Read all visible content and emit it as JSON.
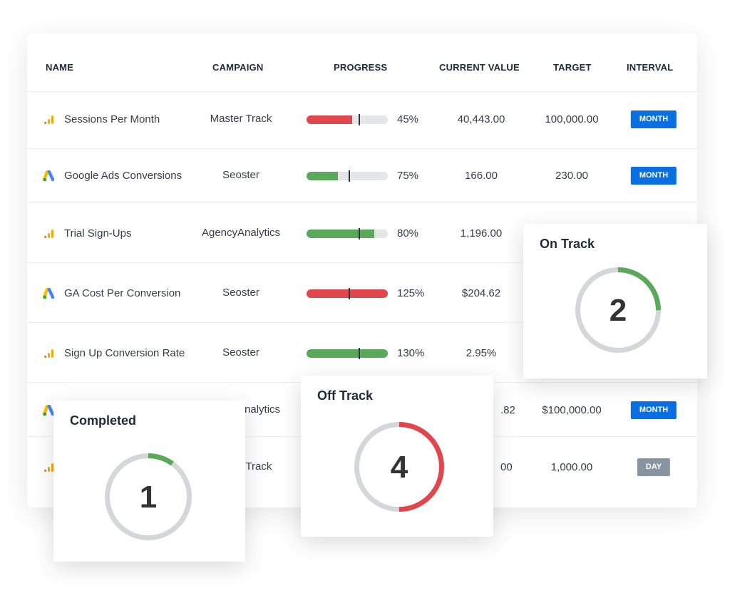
{
  "colors": {
    "red": "#e0474c",
    "green": "#5aa95a",
    "blue": "#0a6fe0",
    "gray": "#8795a1",
    "track": "#d3d7d9"
  },
  "headers": {
    "name": "NAME",
    "campaign": "CAMPAIGN",
    "progress": "PROGRESS",
    "current": "CURRENT VALUE",
    "target": "TARGET",
    "interval": "INTERVAL"
  },
  "rows": [
    {
      "icon": "google-analytics-icon",
      "name": "Sessions Per Month",
      "campaign": "Master Track",
      "pct": "45%",
      "status": "red",
      "fill": 0.56,
      "marker": 0.65,
      "current": "40,443.00",
      "target": "100,000.00",
      "interval": "MONTH"
    },
    {
      "icon": "google-ads-icon",
      "name": "Google Ads Conversions",
      "campaign": "Seoster",
      "pct": "75%",
      "status": "green",
      "fill": 0.39,
      "marker": 0.53,
      "current": "166.00",
      "target": "230.00",
      "interval": "MONTH"
    },
    {
      "icon": "google-analytics-icon",
      "name": "Trial Sign-Ups",
      "campaign": "AgencyAnalytics",
      "pct": "80%",
      "status": "green",
      "fill": 0.83,
      "marker": 0.65,
      "current": "1,196.00"
    },
    {
      "icon": "google-ads-icon",
      "name": "GA Cost Per Conversion",
      "campaign": "Seoster",
      "pct": "125%",
      "status": "red",
      "fill": 1,
      "marker": 0.53,
      "current": "$204.62"
    },
    {
      "icon": "google-analytics-icon",
      "name": "Sign Up Conversion Rate",
      "campaign": "Seoster",
      "pct": "130%",
      "status": "green",
      "fill": 1,
      "marker": 0.65,
      "current": "2.95%"
    },
    {
      "icon": "google-ads-icon",
      "campaign": "AgencyAnalytics",
      "current": ".82",
      "target": "$100,000.00",
      "interval": "MONTH"
    },
    {
      "icon": "google-analytics-icon",
      "campaign": "Master Track",
      "current": "00",
      "target": "1,000.00",
      "interval": "DAY",
      "interval_color": "gray"
    }
  ],
  "cards": {
    "on_track": {
      "title": "On Track",
      "count": "2",
      "fraction": 0.25,
      "color": "green"
    },
    "off_track": {
      "title": "Off Track",
      "count": "4",
      "fraction": 0.5,
      "color": "red"
    },
    "completed": {
      "title": "Completed",
      "count": "1",
      "fraction": 0.1,
      "color": "green"
    }
  }
}
